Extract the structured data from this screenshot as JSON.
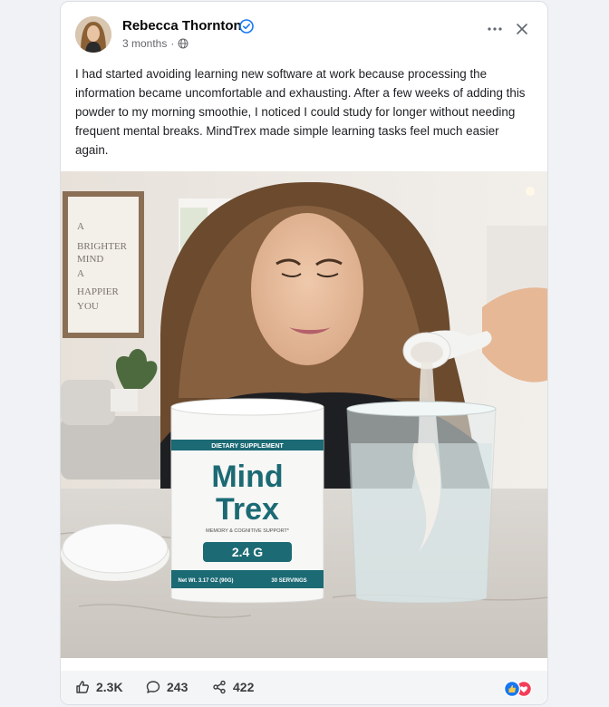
{
  "post": {
    "author": "Rebecca Thornton",
    "verified": true,
    "time": "3 months",
    "separator": "·",
    "audience_icon": "globe-icon",
    "text": "I had started avoiding learning new software at work because processing the information became uncomfortable and exhausting. After a few weeks of adding this powder to my morning smoothie, I noticed I could study for longer without needing frequent mental breaks. MindTrex made simple learning tasks feel much easier again."
  },
  "photo": {
    "wall_art": [
      "A",
      "BRIGHTER",
      "MIND",
      "A",
      "HAPPIER",
      "YOU"
    ],
    "jar": {
      "band": "DIETARY SUPPLEMENT",
      "brand_line1": "Mind",
      "brand_line2": "Trex",
      "tagline": "MEMORY & COGNITIVE SUPPORT*",
      "dose": "2.4 G",
      "net_wt": "Net Wt. 3.17 OZ (90G)",
      "servings": "30 SERVINGS"
    }
  },
  "engagement": {
    "likes": "2.3K",
    "comments": "243",
    "shares": "422"
  },
  "colors": {
    "verified": "#1877f2",
    "brand_teal": "#1b6a74",
    "like_reaction": "#1877f2",
    "love_reaction": "#f33e58"
  }
}
